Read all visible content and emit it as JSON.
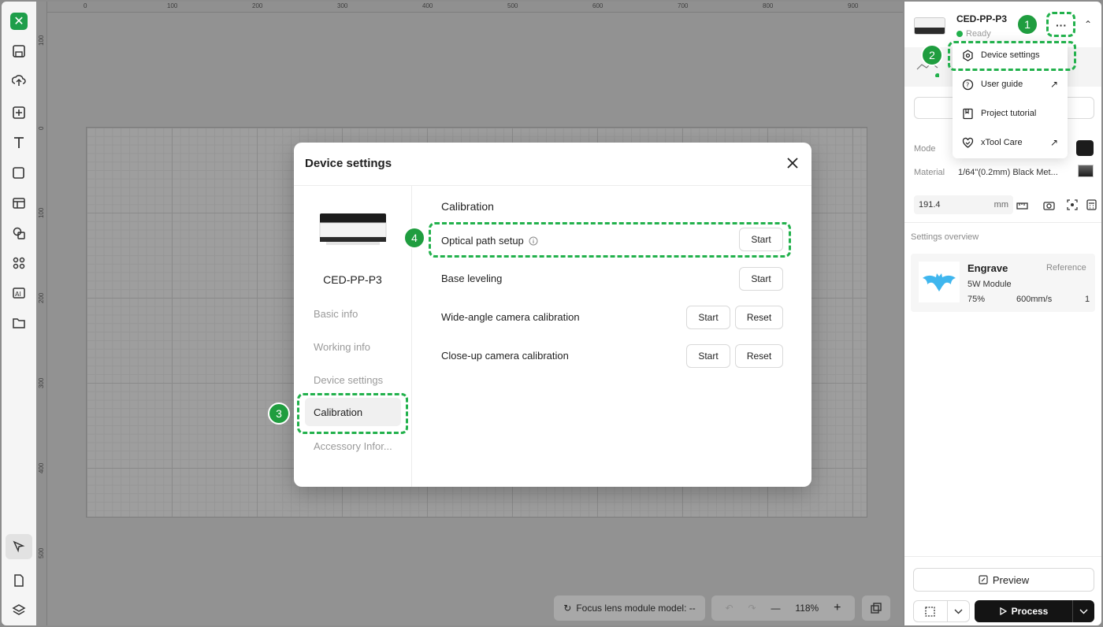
{
  "app": {
    "logo_text": "✕"
  },
  "left_toolbar": {
    "tools": [
      "save-icon",
      "upload-icon",
      "add-icon",
      "text-icon",
      "shape-icon",
      "layout-icon",
      "combine-icon",
      "grid-icon",
      "ai-text-icon",
      "folder-icon",
      "select-icon",
      "document-icon",
      "layers-icon"
    ]
  },
  "canvas": {
    "ruler_top": [
      "0",
      "100",
      "200",
      "300",
      "400",
      "500",
      "600",
      "700",
      "800",
      "900"
    ],
    "ruler_left": [
      "100",
      "0",
      "100",
      "200",
      "300",
      "400",
      "500"
    ],
    "focus_label": "Focus lens module model: --",
    "zoom_level": "118%",
    "zoom_minus": "—",
    "zoom_plus": "+"
  },
  "right_panel": {
    "device_name": "CED-PP-P3",
    "device_status": "Ready",
    "more_label": "···",
    "mode_label": "Mode",
    "material_label": "Material",
    "material_value": "1/64\"(0.2mm) Black Met...",
    "thickness_value": "191.4",
    "thickness_unit": "mm",
    "overview_title": "Settings overview",
    "layer": {
      "title": "Engrave",
      "reference": "Reference",
      "module": "5W Module",
      "power": "75%",
      "speed": "600mm/s",
      "passes": "1"
    },
    "preview_label": "Preview",
    "process_label": "Process"
  },
  "dropdown": {
    "items": [
      {
        "label": "Device settings",
        "icon": "gear-icon"
      },
      {
        "label": "User guide",
        "icon": "help-icon"
      },
      {
        "label": "Project tutorial",
        "icon": "book-icon"
      },
      {
        "label": "xTool Care",
        "icon": "heart-check-icon"
      }
    ]
  },
  "modal": {
    "title": "Device settings",
    "device_name": "CED-PP-P3",
    "nav": [
      "Basic info",
      "Working info",
      "Device settings",
      "Calibration",
      "Accessory Infor..."
    ],
    "active_nav": "Calibration",
    "section_title": "Calibration",
    "rows": [
      {
        "label": "Optical path setup",
        "start": "Start"
      },
      {
        "label": "Base leveling",
        "start": "Start"
      },
      {
        "label": "Wide-angle camera calibration",
        "start": "Start",
        "reset": "Reset"
      },
      {
        "label": "Close-up camera calibration",
        "start": "Start",
        "reset": "Reset"
      }
    ]
  },
  "annotations": {
    "badges": [
      "1",
      "2",
      "3",
      "4"
    ],
    "color": "#22b14c"
  }
}
